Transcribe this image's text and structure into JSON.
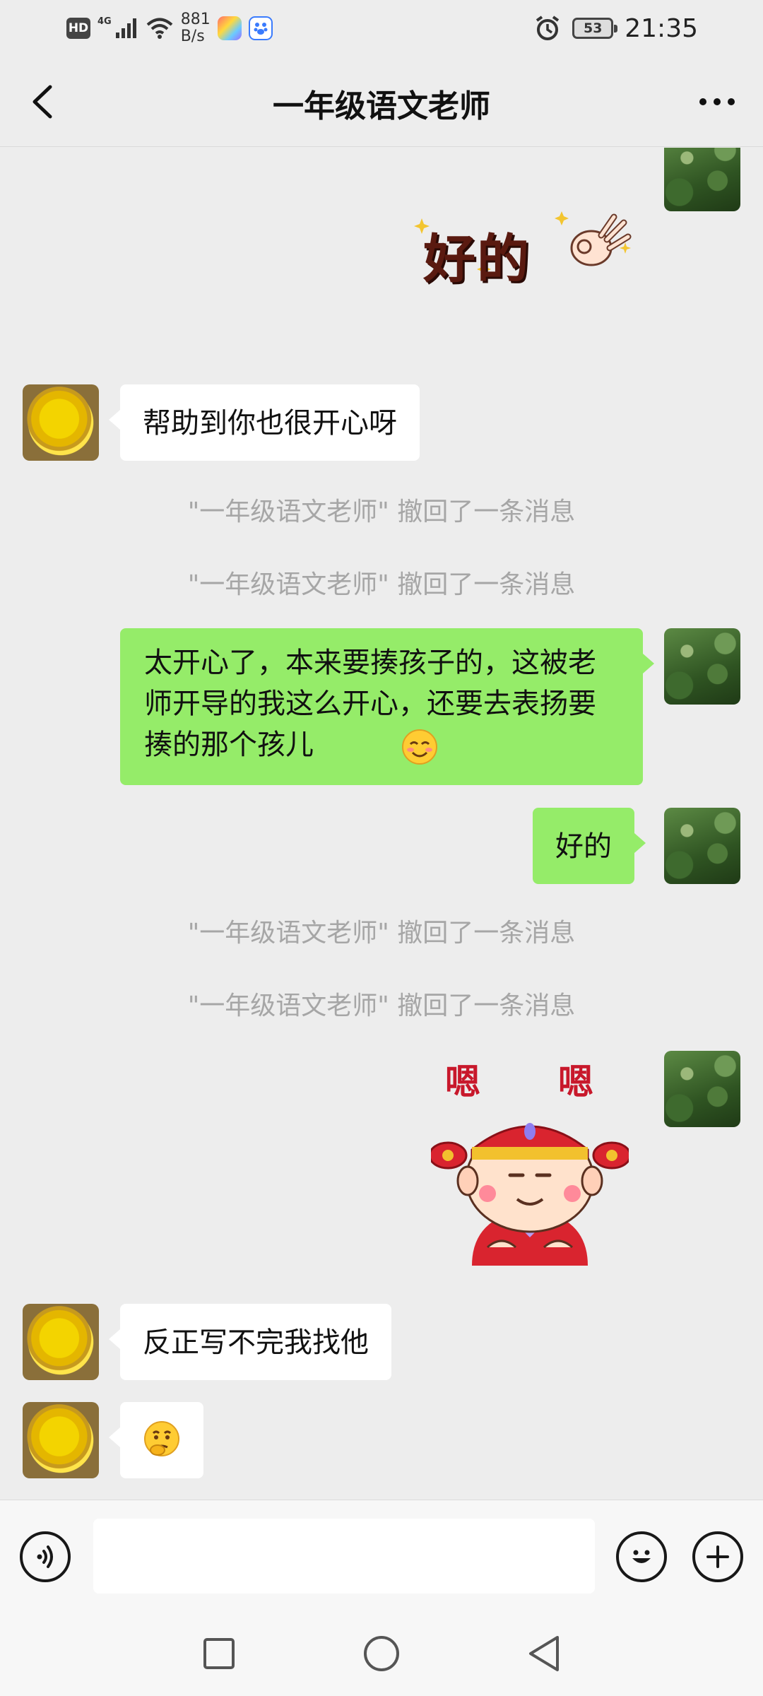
{
  "status_bar": {
    "hd": "HD",
    "network": "4G",
    "speed_value": "881",
    "speed_unit": "B/s",
    "battery": "53",
    "time": "21:35"
  },
  "header": {
    "title": "一年级语文老师"
  },
  "messages": {
    "m2_text": "帮助到你也很开心呀",
    "sys1": "\"一年级语文老师\" 撤回了一条消息",
    "sys2": "\"一年级语文老师\" 撤回了一条消息",
    "m3_text": "太开心了，本来要揍孩子的，这被老师开导的我这么开心，还要去表扬要揍的那个孩儿",
    "m4_text": "好的",
    "sys3": "\"一年级语文老师\" 撤回了一条消息",
    "sys4": "\"一年级语文老师\" 撤回了一条消息",
    "m6_text": "反正写不完我找他",
    "sticker1_text": "好的",
    "sticker2_text_left": "嗯",
    "sticker2_text_right": "嗯"
  },
  "icons": {
    "back": "back-arrow-icon",
    "more": "more-icon",
    "voice": "voice-icon",
    "emoji": "emoji-icon",
    "add": "plus-icon"
  },
  "colors": {
    "sent_bubble": "#95ec69",
    "received_bubble": "#ffffff",
    "background": "#ededed"
  }
}
